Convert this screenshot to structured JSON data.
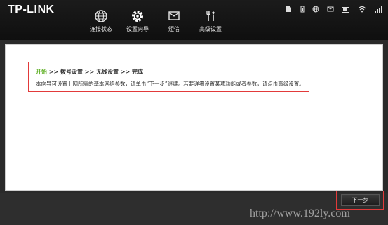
{
  "brand": "TP-LINK",
  "nav": [
    {
      "label": "连接状态",
      "icon": "globe-icon"
    },
    {
      "label": "设置向导",
      "icon": "gear-icon"
    },
    {
      "label": "短信",
      "icon": "envelope-icon"
    },
    {
      "label": "高级设置",
      "icon": "tools-icon"
    }
  ],
  "status_icons": [
    "sim-icon",
    "battery-icon",
    "globe-small-icon",
    "message-icon",
    "battery-level-icon",
    "wifi-icon",
    "signal-icon"
  ],
  "wizard": {
    "step1": "开始",
    "sep": ">>",
    "step2": "拨号设置",
    "step3": "无线设置",
    "step4": "完成",
    "description": "本向导可设置上网所需的基本网络参数，请单击“下一步”继续。若要详细设置某项功能或者参数，请点击高级设置。"
  },
  "next_button": "下一步",
  "watermark": "http://www.192ly.com",
  "colors": {
    "accent": "#66b32e",
    "highlight_border": "#e23a3a",
    "header_bg": "#141414"
  }
}
